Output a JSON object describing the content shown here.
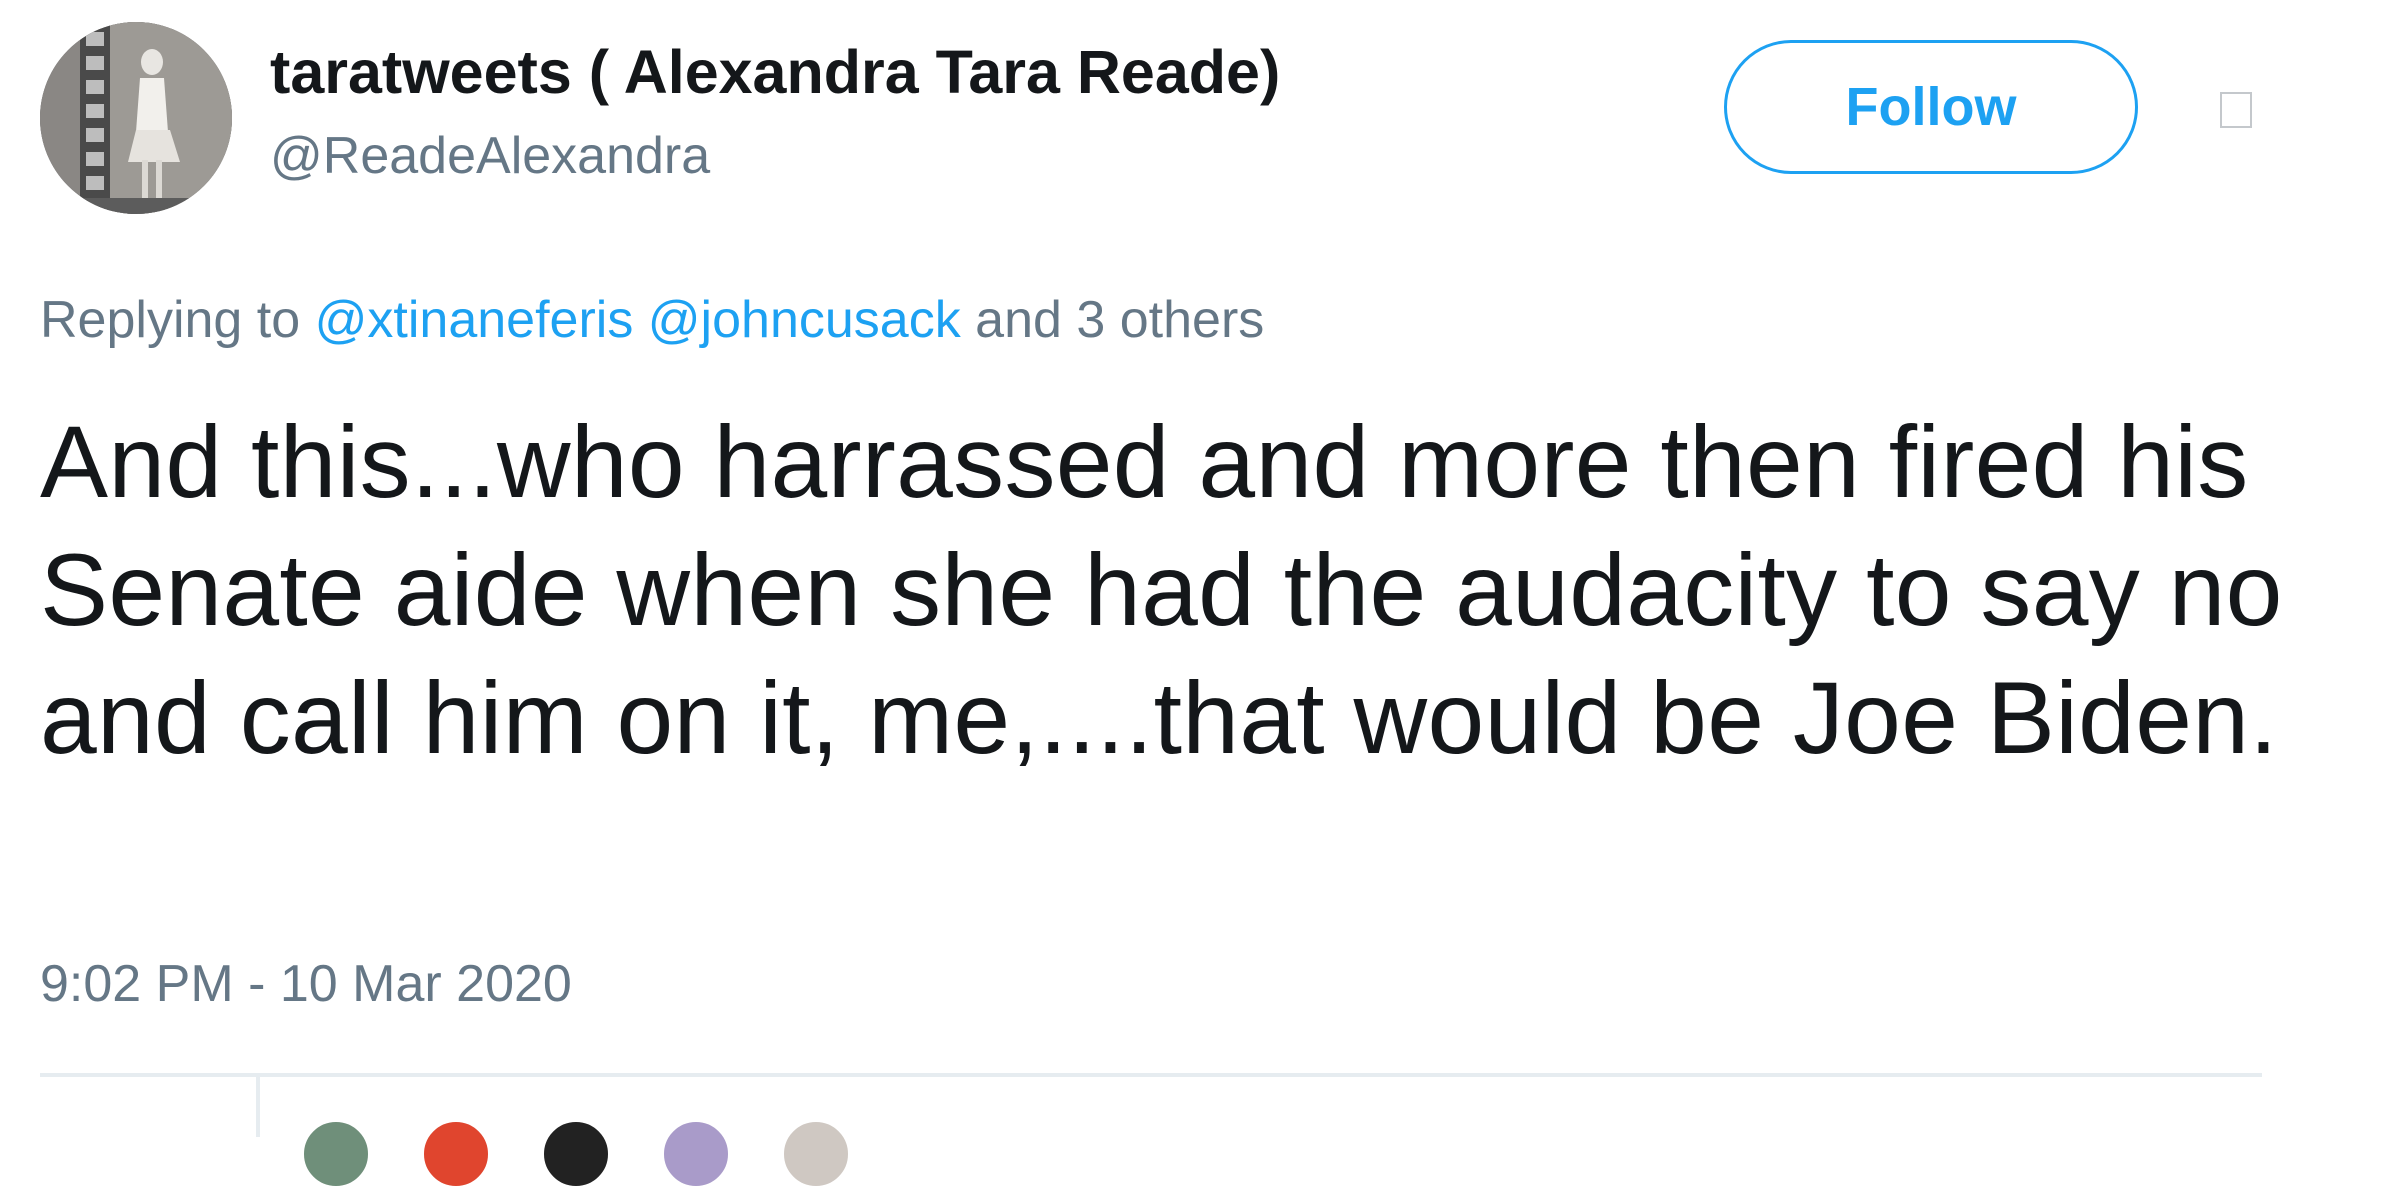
{
  "tweet": {
    "author": {
      "display_name": "taratweets ( Alexandra Tara Reade)",
      "handle": "@ReadeAlexandra",
      "avatar_icon": "avatar-photo"
    },
    "follow_label": "Follow",
    "more_icon": "caret-box-icon",
    "reply_context": {
      "prefix": "Replying to",
      "mentions": [
        "@xtinaneferis",
        "@johncusack"
      ],
      "suffix": "and 3 others"
    },
    "text": "And this...who harrassed and more then fired his Senate aide when she had the audacity to say no and call him on it, me,....that would be Joe Biden.",
    "timestamp": "9:02 PM - 10 Mar 2020"
  },
  "colors": {
    "accent": "#1da1f2",
    "text_primary": "#14171a",
    "text_secondary": "#657786",
    "divider": "#e6ecf0"
  }
}
